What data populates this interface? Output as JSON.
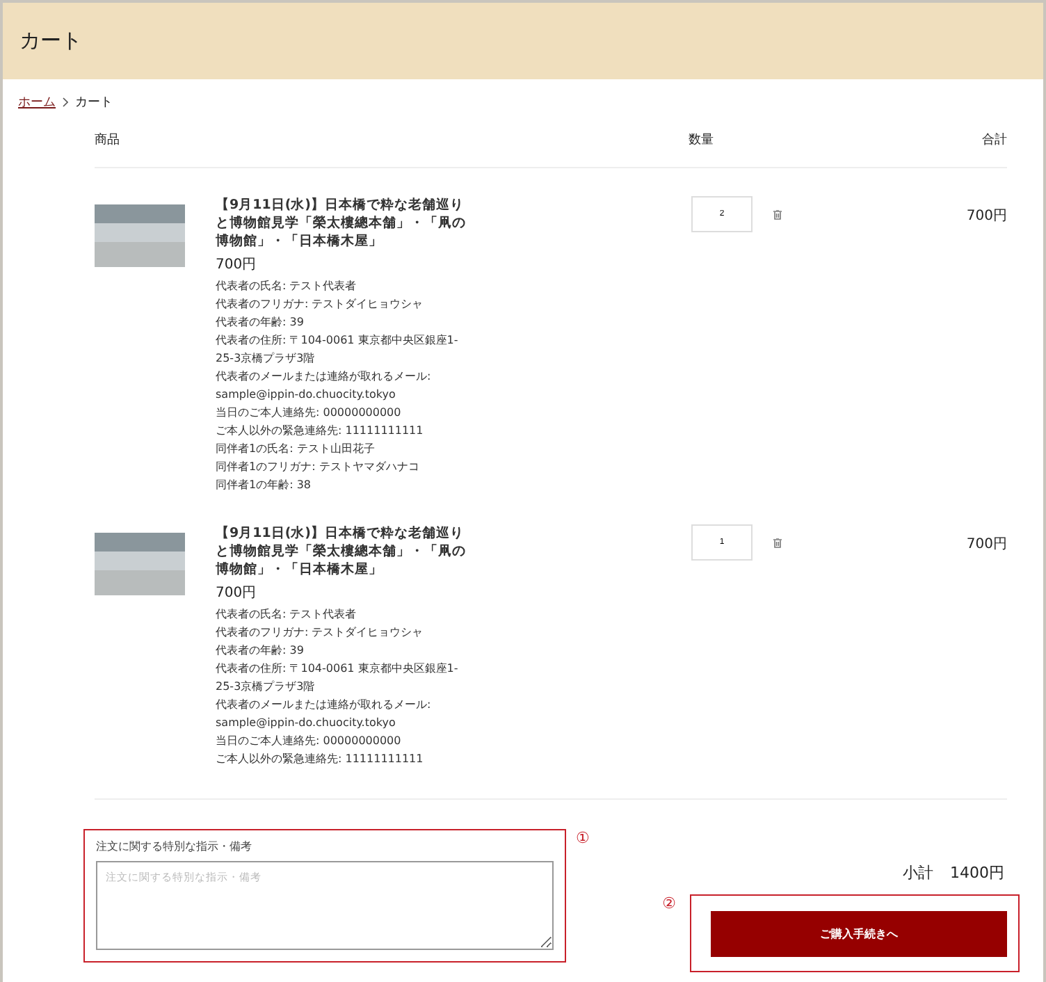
{
  "header": {
    "title": "カート"
  },
  "breadcrumb": [
    {
      "label": "ホーム",
      "kind": "link"
    },
    {
      "label": "カート",
      "kind": "current"
    }
  ],
  "table": {
    "columns": [
      "商品",
      "数量",
      "合計"
    ],
    "rows": [
      {
        "title": "【9月11日(水)】日本橋で粋な老舗巡りと博物館見学「榮太樓總本舗」・「凧の博物館」・「日本橋木屋」",
        "price": "700円",
        "details": [
          "代表者の氏名: テスト代表者",
          "代表者のフリガナ: テストダイヒョウシャ",
          "代表者の年齢: 39",
          "代表者の住所: 〒104-0061 東京都中央区銀座1-25-3京橋プラザ3階",
          "代表者のメールまたは連絡が取れるメール: sample@ippin-do.chuocity.tokyo",
          "当日のご本人連絡先: 00000000000",
          "ご本人以外の緊急連絡先: 11111111111",
          "同伴者1の氏名: テスト山田花子",
          "同伴者1のフリガナ: テストヤマダハナコ",
          "同伴者1の年齢: 38"
        ],
        "quantity": "2",
        "total": "700円"
      },
      {
        "title": "【9月11日(水)】日本橋で粋な老舗巡りと博物館見学「榮太樓總本舗」・「凧の博物館」・「日本橋木屋」",
        "price": "700円",
        "details": [
          "代表者の氏名: テスト代表者",
          "代表者のフリガナ: テストダイヒョウシャ",
          "代表者の年齢: 39",
          "代表者の住所: 〒104-0061 東京都中央区銀座1-25-3京橋プラザ3階",
          "代表者のメールまたは連絡が取れるメール: sample@ippin-do.chuocity.tokyo",
          "当日のご本人連絡先: 00000000000",
          "ご本人以外の緊急連絡先: 11111111111"
        ],
        "quantity": "1",
        "total": "700円"
      }
    ]
  },
  "note": {
    "label": "注文に関する特別な指示・備考",
    "placeholder": "注文に関する特別な指示・備考",
    "marker": "①"
  },
  "subtotal": {
    "label": "小計",
    "value": "1400円"
  },
  "checkout": {
    "label": "ご購入手続きへ",
    "marker": "②"
  }
}
